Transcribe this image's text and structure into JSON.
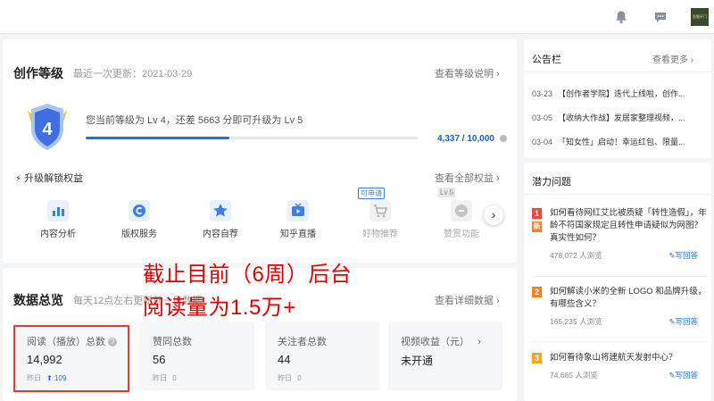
{
  "topbar": {
    "bell_icon": "bell-icon",
    "chat_icon": "chat-bubble-icon",
    "avatar_text": "金融开门"
  },
  "level": {
    "title": "创作等级",
    "updated": "最近一次更新：2021-03-29",
    "more": "查看等级说明",
    "badge_number": "4",
    "status": "您当前等级为 Lv 4，还差 5663 分即可升级为 Lv 5",
    "progress_fraction": 0.4337,
    "points": "4,337 / 10,000",
    "perks_title": "升级解锁权益",
    "perks_more": "查看全部权益",
    "perks": [
      {
        "label": "内容分析",
        "icon": "chart-icon",
        "color": "#3d7ef0",
        "locked": false
      },
      {
        "label": "版权服务",
        "icon": "copyright-icon",
        "color": "#3d7ef0",
        "locked": false
      },
      {
        "label": "内容自荐",
        "icon": "star-icon",
        "color": "#3d7ef0",
        "locked": false
      },
      {
        "label": "知乎直播",
        "icon": "live-tv-icon",
        "color": "#3d7ef0",
        "locked": false
      },
      {
        "label": "好物推荐",
        "icon": "cart-icon",
        "color": "#c9c9c9",
        "locked": true,
        "tag": "可申请"
      },
      {
        "label": "赞赏功能",
        "icon": "coin-icon",
        "color": "#c9c9c9",
        "locked": true,
        "tag": "Lv 5"
      }
    ],
    "next_arrow": "›"
  },
  "overview": {
    "title": "数据总览",
    "sub": "每天12点左右更新前一日数据",
    "more": "查看详细数据",
    "stats": [
      {
        "label": "阅读（播放）总数",
        "value": "14,992",
        "yesterday": "昨日",
        "delta": "109",
        "has_help": true
      },
      {
        "label": "赞同总数",
        "value": "56",
        "yesterday": "昨日",
        "delta": "0"
      },
      {
        "label": "关注者总数",
        "value": "44",
        "yesterday": "昨日",
        "delta": "0"
      },
      {
        "label": "视频收益（元）",
        "value": "未开通",
        "yesterday": "",
        "delta": "",
        "has_arrow": true
      }
    ]
  },
  "annotation": {
    "line1": "截止目前（6周）后台",
    "line2": "阅读量为1.5万+"
  },
  "notice": {
    "title": "公告栏",
    "more": "查看更多",
    "items": [
      {
        "date": "03-23",
        "text": "【创作者学院】迭代上线啦，创作..."
      },
      {
        "date": "03-05",
        "text": "【收纳大作战】发居家整理视频，..."
      },
      {
        "date": "03-04",
        "text": "「知女性」启动！幸运红包、限量..."
      }
    ]
  },
  "potential": {
    "title": "潜力问题",
    "answer_label": "写回答",
    "items": [
      {
        "rank": "1",
        "color": "#e74c3c",
        "new": "新",
        "text": "如何看待网红艾比被质疑「转性造假」，年龄不符国家规定且转性申请疑似为网图？真实性如何？",
        "views": "478,072 人浏览"
      },
      {
        "rank": "2",
        "color": "#f0822e",
        "text": "如何解读小米的全新 LOGO 和品牌升级，有哪些含义？",
        "views": "165,235 人浏览"
      },
      {
        "rank": "3",
        "color": "#f5a623",
        "text": "如何看待象山将建航天发射中心？",
        "views": "74,685 人浏览"
      }
    ]
  }
}
